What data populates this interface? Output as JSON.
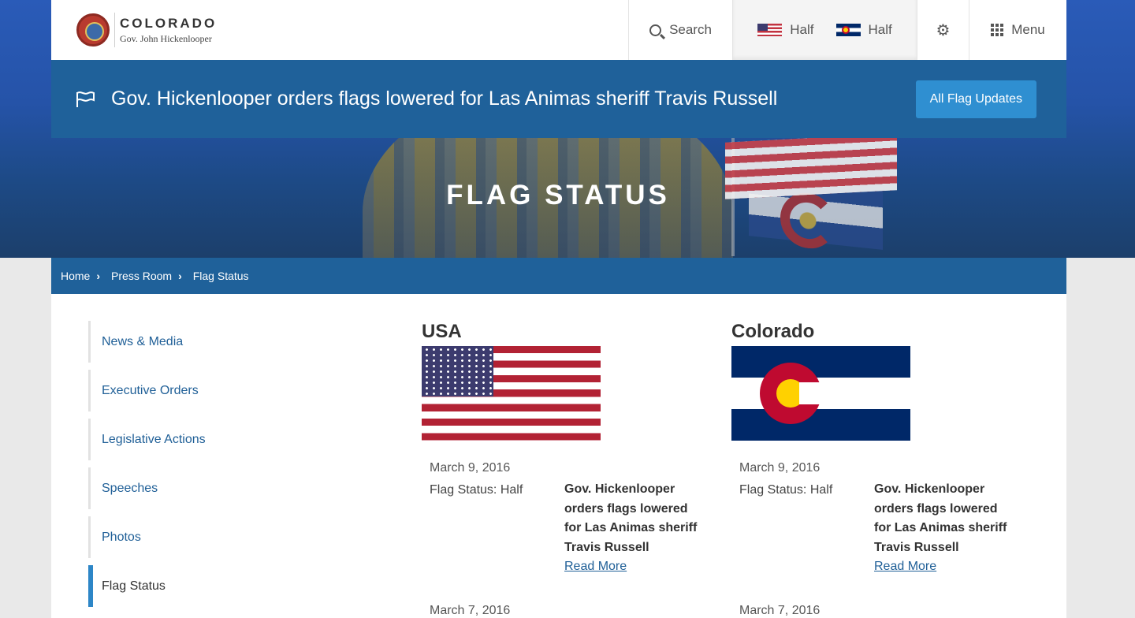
{
  "header": {
    "state_name": "COLORADO",
    "governor": "Gov. John Hickenlooper",
    "search_label": "Search",
    "us_flag_status": "Half",
    "co_flag_status": "Half",
    "menu_label": "Menu"
  },
  "announcement": {
    "text": "Gov. Hickenlooper orders flags lowered for Las Animas sheriff Travis Russell",
    "button_label": "All Flag Updates"
  },
  "hero": {
    "title": "FLAG STATUS"
  },
  "breadcrumb": {
    "items": [
      "Home",
      "Press Room",
      "Flag Status"
    ]
  },
  "sidebar": {
    "items": [
      {
        "label": "News & Media"
      },
      {
        "label": "Executive Orders"
      },
      {
        "label": "Legislative Actions"
      },
      {
        "label": "Speeches"
      },
      {
        "label": "Photos"
      },
      {
        "label": "Flag Status"
      }
    ],
    "active": "Flag Status"
  },
  "flags": [
    {
      "title": "USA",
      "entries": [
        {
          "date": "March 9, 2016",
          "status": "Flag Status: Half",
          "headline": "Gov. Hickenlooper orders flags lowered for Las Animas sheriff Travis Russell",
          "link": "Read More"
        },
        {
          "date": "March 7, 2016"
        }
      ]
    },
    {
      "title": "Colorado",
      "entries": [
        {
          "date": "March 9, 2016",
          "status": "Flag Status: Half",
          "headline": "Gov. Hickenlooper orders flags lowered for Las Animas sheriff Travis Russell",
          "link": "Read More"
        },
        {
          "date": "March 7, 2016"
        }
      ]
    }
  ],
  "colors": {
    "primary_blue": "#1f619a",
    "button_blue": "#2f8fd1",
    "link_blue": "#1f5f97",
    "active_accent": "#2d86c7"
  }
}
